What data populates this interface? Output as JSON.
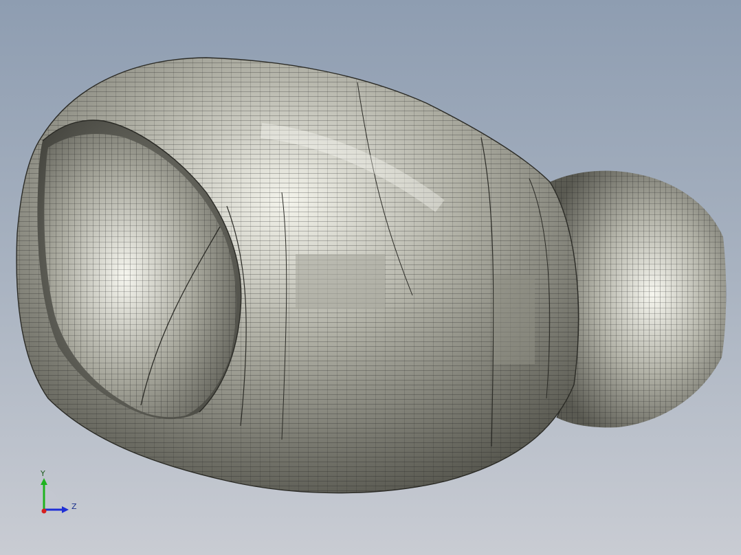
{
  "viewport": {
    "background_top": "#8e9db1",
    "background_bottom": "#c9ccd3"
  },
  "model": {
    "shading_light": "#f4f4ec",
    "shading_mid": "#aeaea3",
    "shading_dark": "#55554d",
    "mesh_color": "#1a1a1a"
  },
  "triad": {
    "y_label": "Y",
    "z_label": "Z",
    "y_color": "#1fb31f",
    "z_color": "#1f2fd6",
    "x_color": "#d61f1f"
  }
}
